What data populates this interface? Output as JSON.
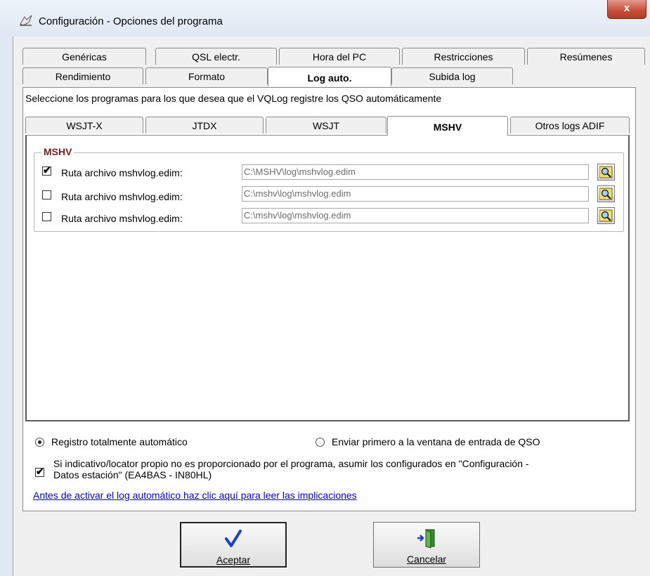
{
  "window": {
    "title": "Configuración - Opciones del programa",
    "close_label": "x"
  },
  "tabs_row1": [
    "Genéricas",
    "QSL electr.",
    "Hora del PC",
    "Restricciones",
    "Resúmenes"
  ],
  "tabs_row2": [
    "Rendimiento",
    "Formato",
    "Log auto.",
    "Subida log"
  ],
  "instruction": "Seleccione los programas para los que desea que el VQLog registre los QSO automáticamente",
  "subtabs": [
    "WSJT-X",
    "JTDX",
    "WSJT",
    "MSHV",
    "Otros logs ADIF"
  ],
  "group": {
    "legend": "MSHV",
    "rows": [
      {
        "checked": true,
        "label": "Ruta archivo mshvlog.edim:",
        "path": "C:\\MSHV\\log\\mshvlog.edim"
      },
      {
        "checked": false,
        "label": "Ruta archivo mshvlog.edim:",
        "path": "C:\\mshv\\log\\mshvlog.edim"
      },
      {
        "checked": false,
        "label": "Ruta archivo mshvlog.edim:",
        "path": "C:\\mshv\\log\\mshvlog.edim"
      }
    ]
  },
  "options": {
    "radio_auto": "Registro totalmente automático",
    "radio_manual": "Enviar primero a la ventana de entrada de QSO",
    "assume_line1": "Si indicativo/locator propio no es proporcionado por el programa, asumir los configurados en \"Configuración -",
    "assume_line2": "Datos estación\" (EA4BAS - IN80HL)",
    "link": "Antes de activar el log automático haz clic aquí para leer las implicaciones"
  },
  "buttons": {
    "ok": "Aceptar",
    "cancel": "Cancelar"
  },
  "colors": {
    "legend": "#7a2020",
    "link": "#0000ee",
    "ok_check": "#1a3fd1"
  }
}
